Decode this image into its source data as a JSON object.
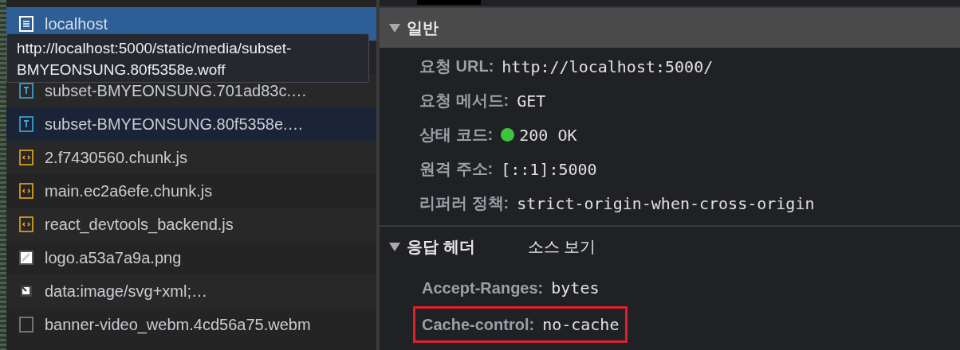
{
  "requests": [
    {
      "name": "localhost",
      "kind": "document",
      "selected": true,
      "hovered": false
    },
    {
      "name": "subset-BMYEONSUNG.701ad83c.…",
      "kind": "font",
      "selected": false,
      "hovered": false
    },
    {
      "name": "subset-BMYEONSUNG.80f5358e.…",
      "kind": "font",
      "selected": false,
      "hovered": true
    },
    {
      "name": "2.f7430560.chunk.js",
      "kind": "script",
      "selected": false,
      "hovered": false
    },
    {
      "name": "main.ec2a6efe.chunk.js",
      "kind": "script",
      "selected": false,
      "hovered": false
    },
    {
      "name": "react_devtools_backend.js",
      "kind": "script",
      "selected": false,
      "hovered": false
    },
    {
      "name": "logo.a53a7a9a.png",
      "kind": "image",
      "selected": false,
      "hovered": false
    },
    {
      "name": "data:image/svg+xml;…",
      "kind": "svg",
      "selected": false,
      "hovered": false
    },
    {
      "name": "banner-video_webm.4cd56a75.webm",
      "kind": "other",
      "selected": false,
      "hovered": false
    }
  ],
  "tooltip": "http://localhost:5000/static/media/subset-BMYEONSUNG.80f5358e.woff",
  "general": {
    "title": "일반",
    "expanded": true,
    "fields": [
      {
        "label": "요청 URL:",
        "value": "http://localhost:5000/"
      },
      {
        "label": "요청 메서드:",
        "value": "GET"
      },
      {
        "label": "상태 코드:",
        "value": "200 OK",
        "color": "#3cc43c"
      },
      {
        "label": "원격 주소:",
        "value": "[::1]:5000"
      },
      {
        "label": "리퍼러 정책:",
        "value": "strict-origin-when-cross-origin"
      }
    ]
  },
  "response_headers": {
    "title": "응답 헤더",
    "expanded": true,
    "view_source": "소스 보기",
    "headers": [
      {
        "name": "Accept-Ranges:",
        "value": "bytes",
        "highlighted": false
      },
      {
        "name": "Cache-control:",
        "value": "no-cache",
        "highlighted": true
      }
    ]
  }
}
